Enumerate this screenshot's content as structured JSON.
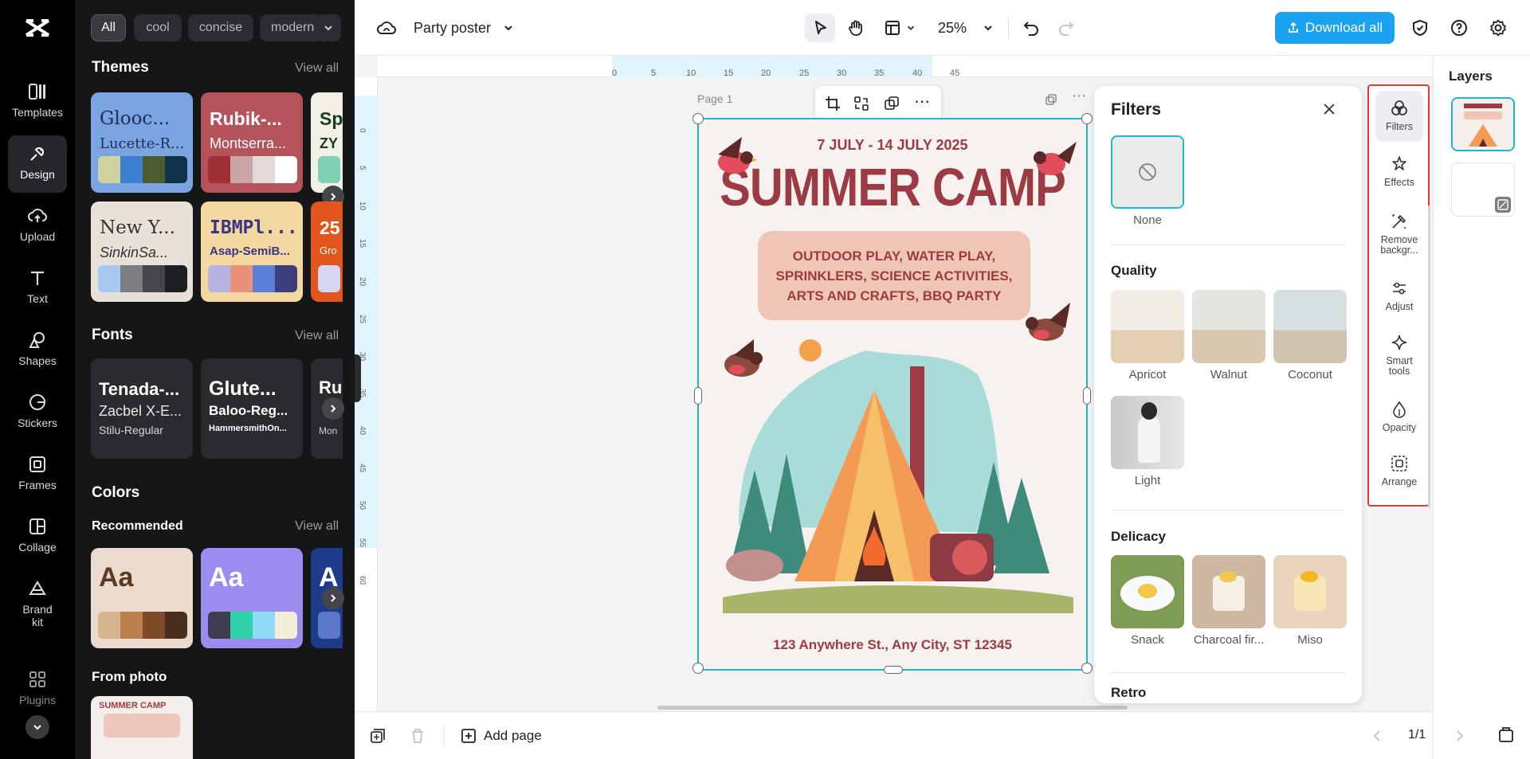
{
  "rail": {
    "items": [
      {
        "label": "Templates",
        "icon": "templates-icon"
      },
      {
        "label": "Design",
        "icon": "design-icon",
        "active": true
      },
      {
        "label": "Upload",
        "icon": "upload-icon"
      },
      {
        "label": "Text",
        "icon": "text-icon"
      },
      {
        "label": "Shapes",
        "icon": "shapes-icon"
      },
      {
        "label": "Stickers",
        "icon": "stickers-icon"
      },
      {
        "label": "Frames",
        "icon": "frames-icon"
      },
      {
        "label": "Collage",
        "icon": "collage-icon"
      },
      {
        "label": "Brand kit",
        "icon": "brand-kit-icon"
      },
      {
        "label": "Plugins",
        "icon": "plugins-icon"
      }
    ]
  },
  "panel": {
    "chips": [
      "All",
      "cool",
      "concise",
      "modern"
    ],
    "themes": {
      "title": "Themes",
      "view_all": "View all",
      "cards": [
        {
          "t1": "Glooc...",
          "t2": "Lucette-R...",
          "bg": "#7ba4e0",
          "fg": "#1c2f5c",
          "swatches": [
            "#cfd3a1",
            "#3d7fd1",
            "#4d5b30",
            "#10314a"
          ]
        },
        {
          "t1": "Rubik-...",
          "t2": "Montserra...",
          "bg": "#b5535a",
          "fg": "#ffffff",
          "swatches": [
            "#9e2f35",
            "#c9a5a6",
            "#e5dada",
            "#ffffff"
          ]
        },
        {
          "t1": "Sp",
          "t2": "ZY",
          "bg": "#f2efe3",
          "fg": "#183a2b",
          "swatches": [
            "#7fd1b5",
            "#ffffff"
          ]
        },
        {
          "t1": "New Y...",
          "t2": "SinkinSa...",
          "bg": "#e8e1d9",
          "fg": "#333333",
          "swatches": [
            "#a8c8ef",
            "#7c7d80",
            "#44464c",
            "#1d1e22"
          ]
        },
        {
          "t1": "IBMPl...",
          "t2": "Asap-SemiB...",
          "bg": "#f3d9a0",
          "fg": "#3b3480",
          "swatches": [
            "#b7b3e0",
            "#e89279",
            "#5b7ed8",
            "#3c3e7c"
          ]
        },
        {
          "t1": "25",
          "t2": "Gro",
          "bg": "#e2551c",
          "fg": "#ffffff",
          "swatches": [
            "#d6d6f5"
          ]
        }
      ]
    },
    "fonts": {
      "title": "Fonts",
      "view_all": "View all",
      "cards": [
        {
          "t1": "Tenada-...",
          "t2": "Zacbel X-E...",
          "t3": "Stilu-Regular"
        },
        {
          "t1": "Glute...",
          "t2": "Baloo-Reg...",
          "t3": "HammersmithOn..."
        },
        {
          "t1": "Ru",
          "t2": "",
          "t3": "Mon"
        }
      ]
    },
    "colors": {
      "title": "Colors",
      "subtitle": "Recommended",
      "view_all": "View all",
      "cards": [
        {
          "label": "Aa",
          "bg": "#eadbce",
          "fg": "#5a3a22",
          "swatches": [
            "#d8b48f",
            "#b9824c",
            "#7e4b2a",
            "#4a2e1d"
          ]
        },
        {
          "label": "Aa",
          "bg": "#9b8df0",
          "fg": "#ffffff",
          "swatches": [
            "#3f3d52",
            "#2fd1a8",
            "#8fdcf8",
            "#f4efd9"
          ]
        },
        {
          "label": "A",
          "bg": "#1f3c8a",
          "fg": "#ffffff",
          "swatches": [
            "#5a78c8"
          ]
        }
      ]
    },
    "from_photo": {
      "title": "From photo",
      "thumb_text": "SUMMER CAMP"
    }
  },
  "topbar": {
    "doc_title": "Party poster",
    "zoom": "25%",
    "download": "Download all"
  },
  "canvas": {
    "page_label": "Page 1",
    "ruler_h": [
      "0",
      "5",
      "10",
      "15",
      "20",
      "25",
      "30",
      "35",
      "40",
      "45"
    ],
    "ruler_v": [
      "0",
      "5",
      "10",
      "15",
      "20",
      "25",
      "30",
      "35",
      "40",
      "45",
      "50",
      "55",
      "60"
    ],
    "poster": {
      "date": "7 JULY - 14 JULY 2025",
      "title": "SUMMER CAMP",
      "activities": "OUTDOOR PLAY, WATER PLAY, SPRINKLERS, SCIENCE ACTIVITIES, ARTS AND CRAFTS, BBQ PARTY",
      "address": "123 Anywhere St., Any City, ST 12345"
    }
  },
  "filters": {
    "title": "Filters",
    "none_label": "None",
    "sections": [
      {
        "title": "Quality",
        "items": [
          "Apricot",
          "Walnut",
          "Coconut",
          "Light"
        ]
      },
      {
        "title": "Delicacy",
        "items": [
          "Snack",
          "Charcoal fir...",
          "Miso"
        ]
      },
      {
        "title": "Retro",
        "items": []
      }
    ]
  },
  "tools": [
    {
      "label": "Filters",
      "icon": "filters-icon",
      "active": true
    },
    {
      "label": "Effects",
      "icon": "effects-icon"
    },
    {
      "label": "Remove backgr...",
      "icon": "remove-background-icon"
    },
    {
      "label": "Adjust",
      "icon": "adjust-icon"
    },
    {
      "label": "Smart tools",
      "icon": "smart-tools-icon"
    },
    {
      "label": "Opacity",
      "icon": "opacity-icon"
    },
    {
      "label": "Arrange",
      "icon": "arrange-icon"
    }
  ],
  "layers": {
    "title": "Layers"
  },
  "bottombar": {
    "add_page": "Add page",
    "page_count": "1/1"
  },
  "colors": {
    "accent": "#1aa3f0",
    "selection": "#1fb6d3",
    "highlight": "#e53935",
    "poster_title": "#9c3b43"
  }
}
